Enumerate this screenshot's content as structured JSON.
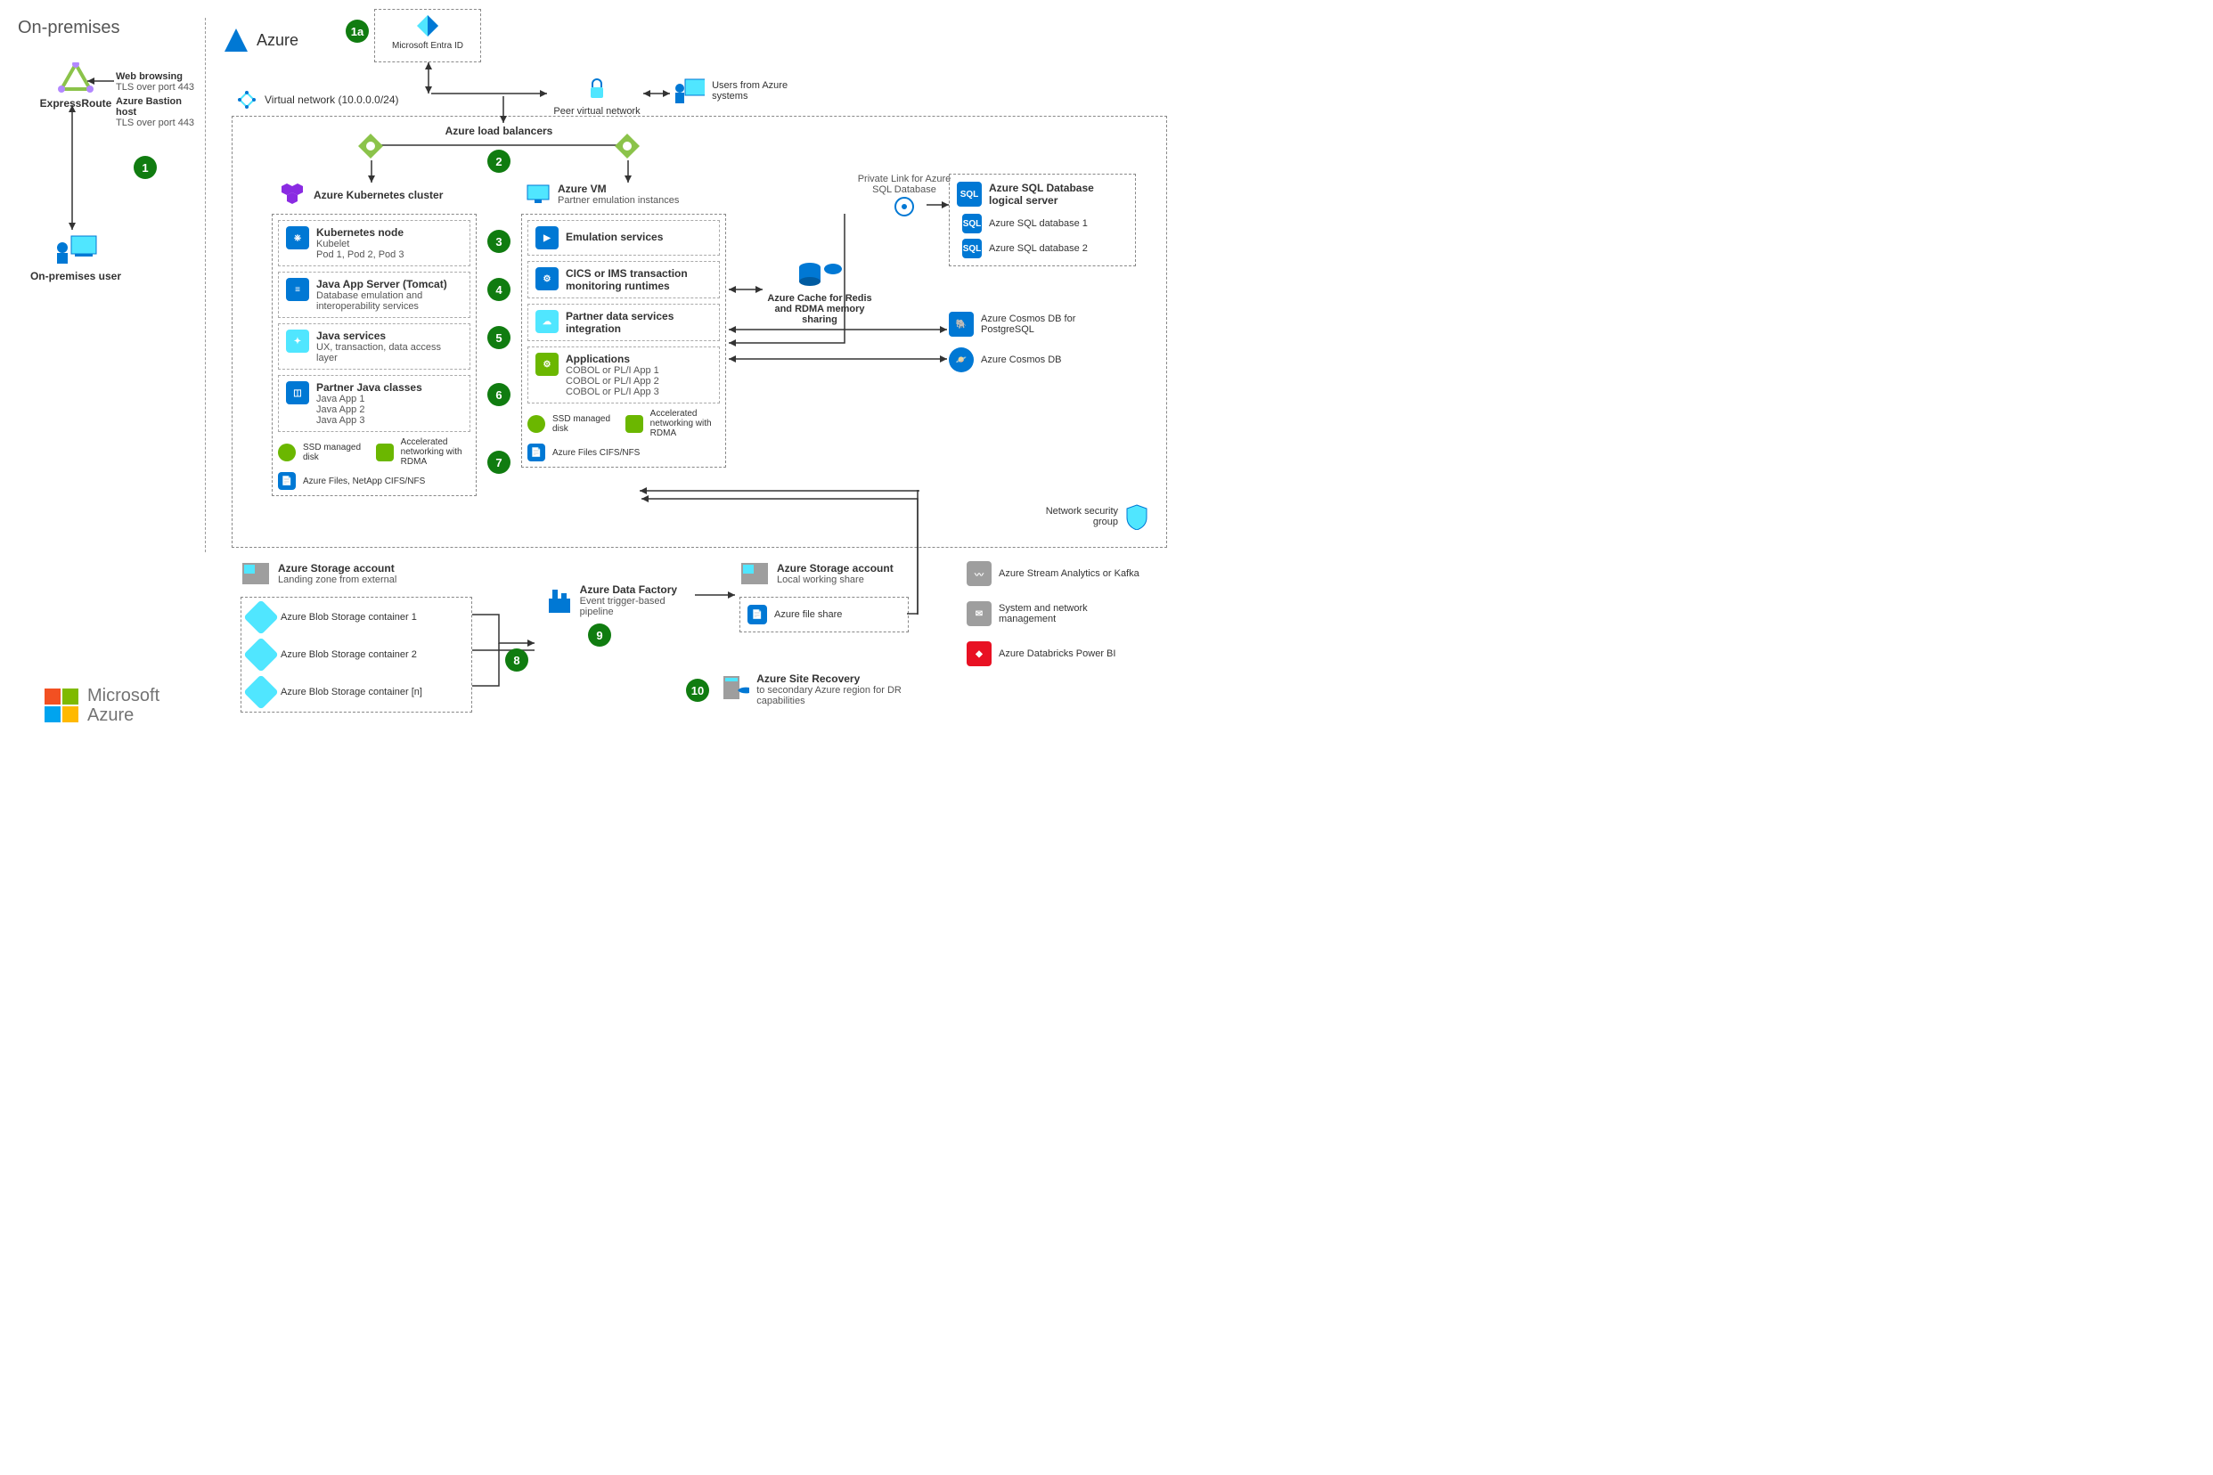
{
  "onprem": {
    "title": "On-premises",
    "expressroute": "ExpressRoute",
    "user": "On-premises user",
    "web_browsing": "Web browsing",
    "tls443_1": "TLS over port 443",
    "bastion": "Azure Bastion host",
    "tls443_2": "TLS over port 443"
  },
  "azure_label": "Azure",
  "entra": "Microsoft Entra ID",
  "vnet_label": "Virtual network (10.0.0.0/24)",
  "peer_vnet": "Peer virtual network",
  "users_azure": "Users from Azure systems",
  "load_balancers": "Azure load balancers",
  "aks": {
    "title": "Azure Kubernetes cluster",
    "node_title": "Kubernetes node",
    "node_sub1": "Kubelet",
    "node_sub2": "Pod 1, Pod 2, Pod 3",
    "java_server_title": "Java App Server (Tomcat)",
    "java_server_sub": "Database emulation and interoperability services",
    "java_svc_title": "Java services",
    "java_svc_sub": "UX, transaction, data access layer",
    "partner_title": "Partner Java classes",
    "partner_sub1": "Java App 1",
    "partner_sub2": "Java App 2",
    "partner_sub3": "Java App 3",
    "ssd": "SSD managed disk",
    "accel": "Accelerated networking with RDMA",
    "files": "Azure Files, NetApp CIFS/NFS"
  },
  "vm": {
    "title": "Azure VM",
    "subtitle": "Partner emulation instances",
    "emu": "Emulation services",
    "cics": "CICS or IMS transaction monitoring runtimes",
    "partner_data": "Partner data services integration",
    "apps_title": "Applications",
    "apps1": "COBOL or PL/I App 1",
    "apps2": "COBOL or PL/I App 2",
    "apps3": "COBOL or PL/I App 3",
    "ssd": "SSD managed disk",
    "accel": "Accelerated networking with RDMA",
    "files": "Azure Files CIFS/NFS"
  },
  "cache": "Azure Cache for Redis and RDMA memory sharing",
  "private_link": "Private Link for Azure SQL Database",
  "sql_server": "Azure SQL Database logical server",
  "sql_db1": "Azure SQL database 1",
  "sql_db2": "Azure SQL database 2",
  "cosmos_pg": "Azure Cosmos DB for PostgreSQL",
  "cosmos": "Azure Cosmos DB",
  "nsg": "Network security group",
  "storage1": {
    "title": "Azure Storage account",
    "subtitle": "Landing zone from external",
    "blob1": "Azure Blob Storage container 1",
    "blob2": "Azure Blob Storage container 2",
    "blobn": "Azure Blob Storage container [n]"
  },
  "adf": {
    "title": "Azure Data Factory",
    "subtitle": "Event trigger-based pipeline"
  },
  "storage2": {
    "title": "Azure Storage account",
    "subtitle": "Local working share",
    "fileshare": "Azure file share"
  },
  "asr": {
    "title": "Azure Site Recovery",
    "subtitle": "to secondary Azure region for DR capabilities"
  },
  "right_services": {
    "stream": "Azure Stream Analytics or Kafka",
    "sysmgmt": "System and network management",
    "databricks": "Azure Databricks Power BI"
  },
  "steps": {
    "s1": "1",
    "s1a": "1a",
    "s2": "2",
    "s3": "3",
    "s4": "4",
    "s5": "5",
    "s6": "6",
    "s7": "7",
    "s8": "8",
    "s9": "9",
    "s10": "10"
  },
  "footer_brand": "Microsoft Azure"
}
